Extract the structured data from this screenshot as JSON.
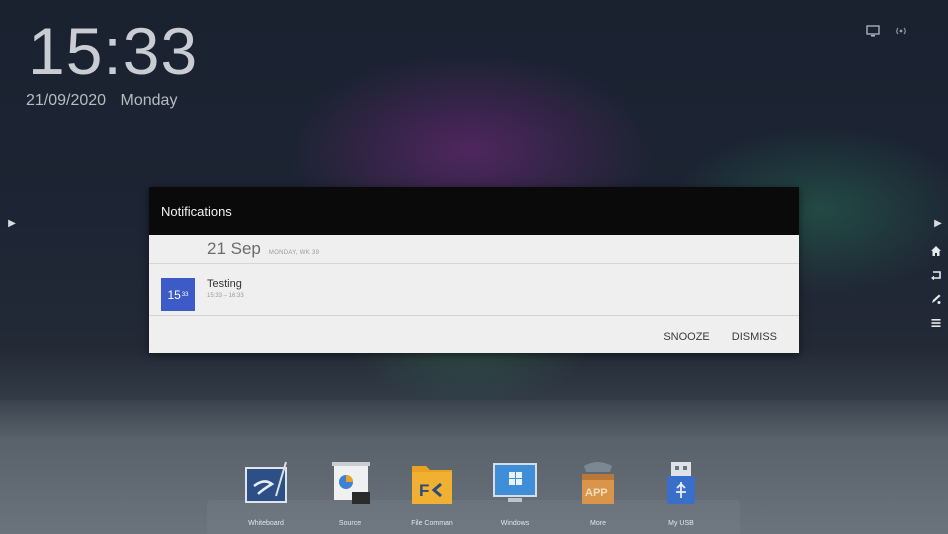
{
  "clock": {
    "time": "15:33",
    "date": "21/09/2020",
    "weekday": "Monday"
  },
  "notification": {
    "header": "Notifications",
    "day": "21 Sep",
    "week_info": "MONDAY, WK 39",
    "event": {
      "badge_hour": "15",
      "badge_minute": "33",
      "title": "Testing",
      "time_range": "15:33 – 16:33"
    },
    "actions": {
      "snooze": "SNOOZE",
      "dismiss": "DISMISS"
    }
  },
  "dock": {
    "items": [
      {
        "label": "Whiteboard",
        "icon": "whiteboard-icon"
      },
      {
        "label": "Source",
        "icon": "source-icon"
      },
      {
        "label": "File Comman",
        "icon": "file-commander-icon"
      },
      {
        "label": "Windows",
        "icon": "windows-icon"
      },
      {
        "label": "More",
        "icon": "app-store-icon"
      },
      {
        "label": "My USB",
        "icon": "usb-icon"
      }
    ]
  },
  "status_icons": [
    "display-icon",
    "wireless-icon"
  ],
  "right_toolbar": [
    "home-icon",
    "back-icon",
    "annotate-icon",
    "menu-icon"
  ],
  "colors": {
    "event_badge": "#3d5bc6",
    "file_commander": "#e9a321",
    "header_bg": "#0a0a0a"
  }
}
